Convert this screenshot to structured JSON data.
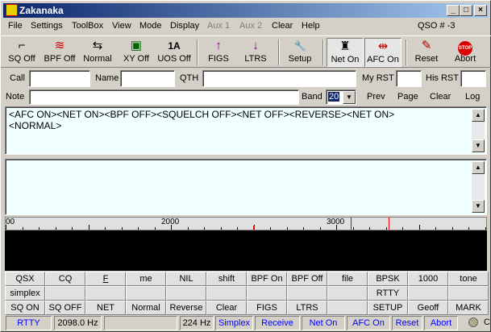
{
  "window": {
    "title": "Zakanaka",
    "min": "_",
    "max": "□",
    "close": "×"
  },
  "menu": {
    "items": [
      "File",
      "Settings",
      "ToolBox",
      "View",
      "Mode",
      "Display",
      "Aux 1",
      "Aux 2",
      "Clear",
      "Help"
    ],
    "qso": "QSO # -3"
  },
  "toolbar": [
    {
      "label": "SQ Off",
      "icon": "squelch-icon",
      "glyph": "⌐"
    },
    {
      "label": "BPF Off",
      "icon": "filter-wave-icon",
      "glyph": "≋"
    },
    {
      "label": "Normal",
      "icon": "normal-arrows-icon",
      "glyph": "⇆"
    },
    {
      "label": "XY Off",
      "icon": "scope-icon",
      "glyph": "▣"
    },
    {
      "label": "UOS Off",
      "icon": "uos-icon",
      "glyph": "1A"
    },
    {
      "label": "FIGS",
      "icon": "arrow-up-icon",
      "glyph": "↑"
    },
    {
      "label": "LTRS",
      "icon": "arrow-down-icon",
      "glyph": "↓"
    },
    {
      "label": "Setup",
      "icon": "wrench-icon",
      "glyph": "🔧"
    },
    {
      "label": "Net On",
      "icon": "net-icon",
      "glyph": "♜"
    },
    {
      "label": "AFC On",
      "icon": "afc-icon",
      "glyph": "⇹"
    },
    {
      "label": "Reset",
      "icon": "reset-icon",
      "glyph": "✎"
    },
    {
      "label": "Abort",
      "icon": "stop-icon",
      "glyph": "STOP"
    }
  ],
  "fields": {
    "call": "Call",
    "name": "Name",
    "qth": "QTH",
    "my_rst": "My RST",
    "his_rst": "His RST",
    "note": "Note",
    "band": "Band",
    "band_value": "20",
    "prev": "Prev",
    "page": "Page",
    "clear": "Clear",
    "log": "Log"
  },
  "rx_text": "<AFC ON><NET ON><BPF OFF><SQUELCH OFF><NET OFF><REVERSE><NET ON>\n<NORMAL>",
  "tx_text": "",
  "ruler": {
    "labels": [
      "00",
      "2000",
      "3000"
    ]
  },
  "macros": [
    [
      "QSX",
      "CQ",
      "F",
      "me",
      "NIL",
      "shift",
      "BPF On",
      "BPF Off",
      "file",
      "BPSK",
      "1000",
      "tone"
    ],
    [
      "simplex",
      "",
      "",
      "",
      "",
      "",
      "",
      "",
      "",
      "RTTY",
      "",
      ""
    ],
    [
      "SQ ON",
      "SQ OFF",
      "NET",
      "Normal",
      "Reverse",
      "Clear",
      "FIGS",
      "LTRS",
      "",
      "SETUP",
      "Geoff",
      "MARK"
    ]
  ],
  "status": {
    "mode": "RTTY",
    "freq": "2098.0 Hz",
    "blank": "",
    "shift": "224 Hz",
    "simplex": "Simplex",
    "receive": "Receive",
    "net": "Net On",
    "afc": "AFC On",
    "reset": "Reset",
    "abort": "Abort",
    "c": "C"
  }
}
